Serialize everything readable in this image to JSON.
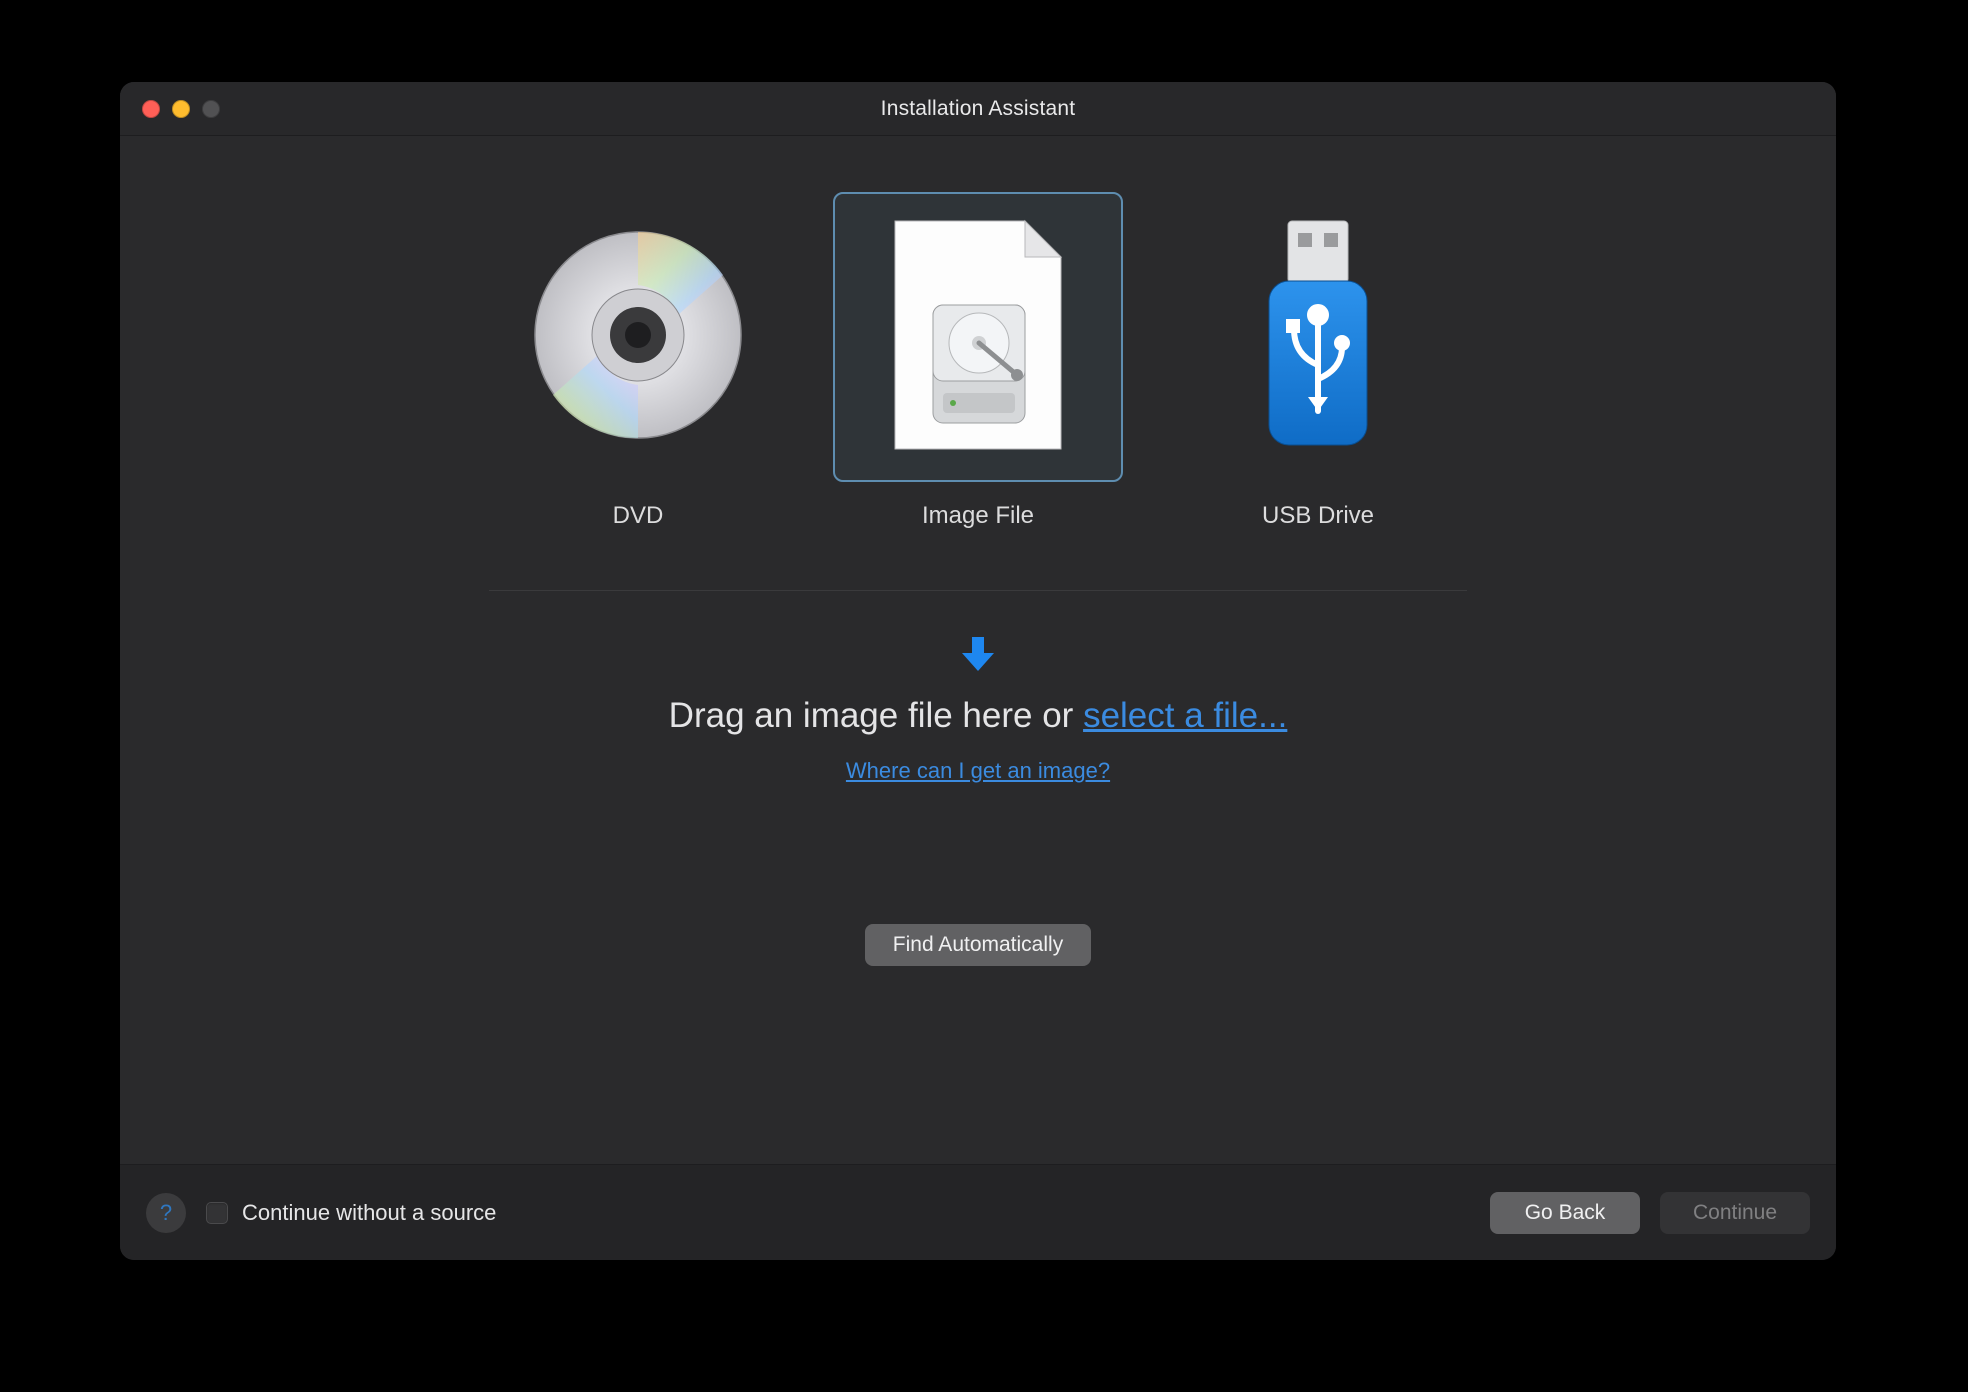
{
  "window": {
    "title": "Installation Assistant"
  },
  "sources": {
    "dvd": {
      "label": "DVD"
    },
    "image": {
      "label": "Image File",
      "selected": true
    },
    "usb": {
      "label": "USB Drive"
    }
  },
  "drop": {
    "prefix": "Drag an image file here or ",
    "select_link": "select a file...",
    "where_link": "Where can I get an image?"
  },
  "buttons": {
    "find_auto": "Find Automatically",
    "go_back": "Go Back",
    "continue": "Continue"
  },
  "footer": {
    "continue_without_source": "Continue without a source",
    "continue_without_source_checked": false,
    "continue_enabled": false,
    "help_glyph": "?"
  }
}
